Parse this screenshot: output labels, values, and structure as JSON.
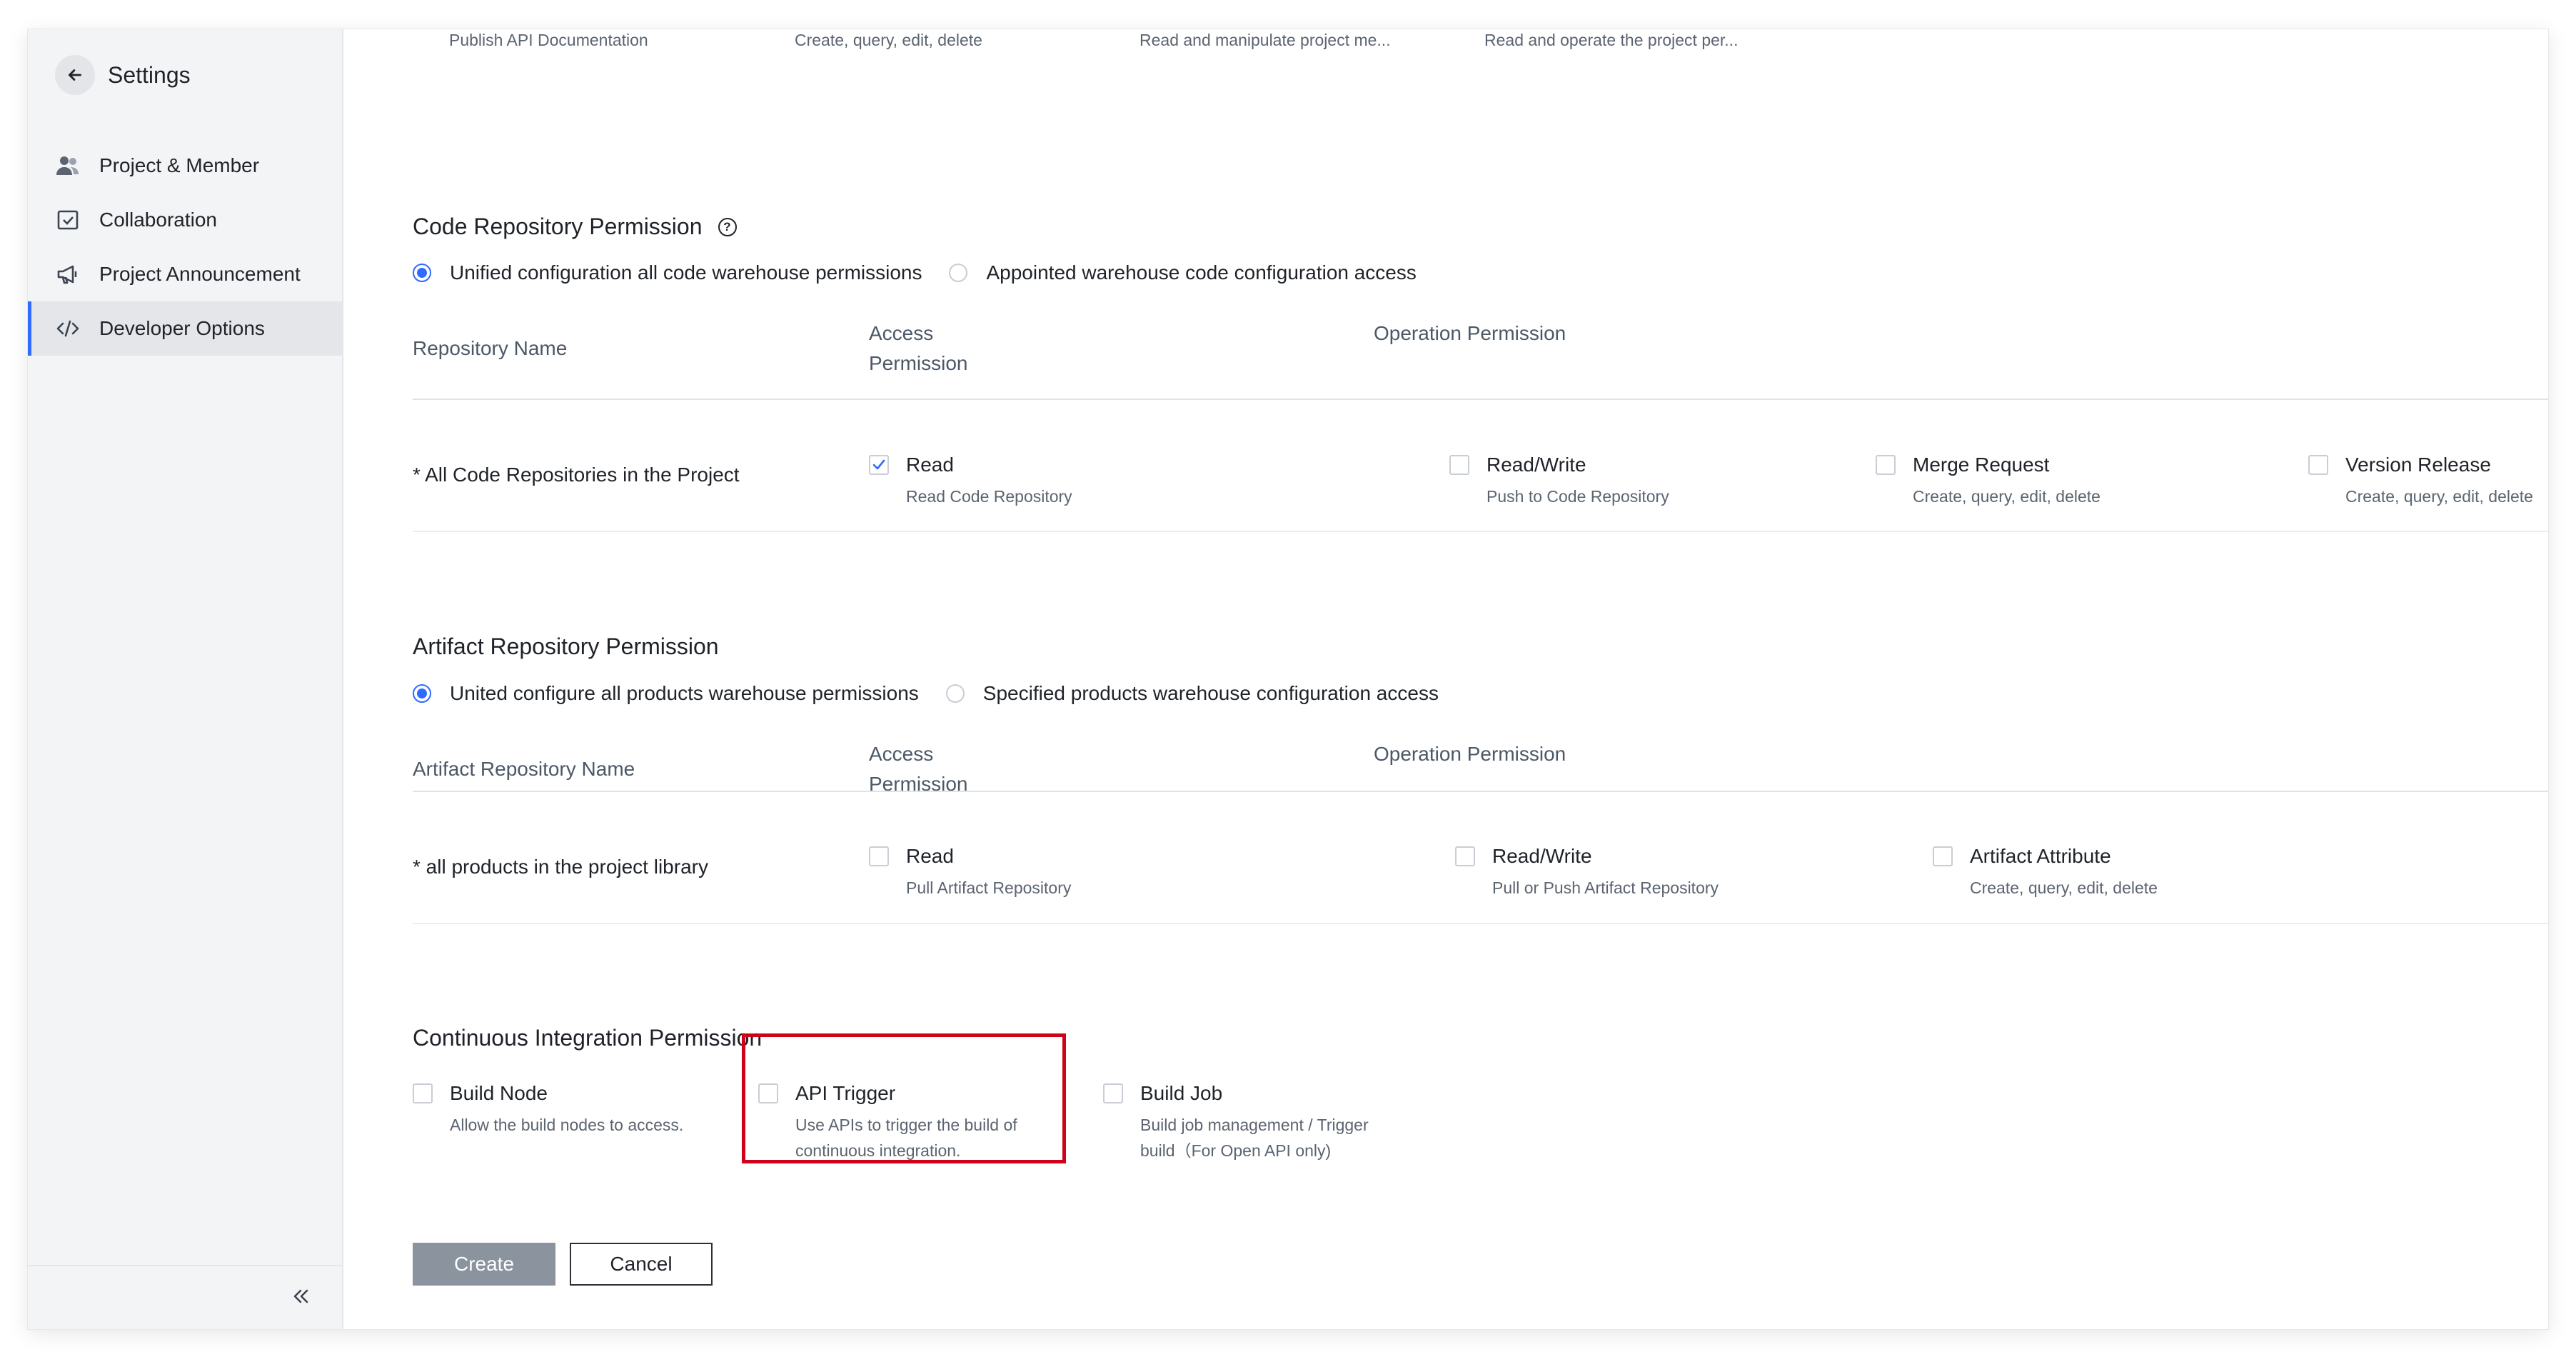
{
  "sidebar": {
    "title": "Settings",
    "items": [
      {
        "label": "Project & Member",
        "icon": "users-icon"
      },
      {
        "label": "Collaboration",
        "icon": "check-square-icon"
      },
      {
        "label": "Project Announcement",
        "icon": "megaphone-icon"
      },
      {
        "label": "Developer Options",
        "icon": "code-icon",
        "active": true
      }
    ]
  },
  "top_row": {
    "items": [
      "Publish API Documentation",
      "Create, query, edit, delete",
      "Read and manipulate project me...",
      "Read and operate the project per..."
    ]
  },
  "code_repo": {
    "title": "Code Repository Permission",
    "radio_unified": "Unified configuration all code warehouse permissions",
    "radio_appointed": "Appointed warehouse code configuration access",
    "col_name": "Repository Name",
    "col_access_1": "Access",
    "col_access_2": "Permission",
    "col_operation": "Operation Permission",
    "row_label": "* All Code Repositories in the Project",
    "perms": [
      {
        "title": "Read",
        "desc": "Read Code Repository",
        "checked": true
      },
      {
        "title": "Read/Write",
        "desc": "Push to Code Repository",
        "checked": false
      },
      {
        "title": "Merge Request",
        "desc": "Create, query, edit, delete",
        "checked": false
      },
      {
        "title": "Version Release",
        "desc": "Create, query, edit, delete",
        "checked": false
      }
    ]
  },
  "artifact_repo": {
    "title": "Artifact Repository Permission",
    "radio_unified": "United configure all products warehouse permissions",
    "radio_specified": "Specified products warehouse configuration access",
    "col_name": "Artifact Repository Name",
    "col_access_1": "Access",
    "col_access_2": "Permission",
    "col_operation": "Operation Permission",
    "row_label": "* all products in the project library",
    "perms": [
      {
        "title": "Read",
        "desc": "Pull Artifact Repository",
        "checked": false
      },
      {
        "title": "Read/Write",
        "desc": "Pull or Push Artifact Repository",
        "checked": false
      },
      {
        "title": "Artifact Attribute",
        "desc": "Create, query, edit, delete",
        "checked": false
      }
    ]
  },
  "ci": {
    "title": "Continuous Integration Permission",
    "perms": [
      {
        "title": "Build Node",
        "desc_1": "Allow the build nodes to access.",
        "desc_2": "",
        "checked": false
      },
      {
        "title": "API Trigger",
        "desc_1": "Use APIs to trigger the build of",
        "desc_2": "continuous integration.",
        "checked": false
      },
      {
        "title": "Build Job",
        "desc_1": "Build job management / Trigger",
        "desc_2": "build（For Open API only)",
        "checked": false
      }
    ]
  },
  "actions": {
    "create": "Create",
    "cancel": "Cancel"
  },
  "colors": {
    "accent": "#2f6bff",
    "highlight": "#d0021b",
    "primary_disabled": "#8a939e"
  }
}
